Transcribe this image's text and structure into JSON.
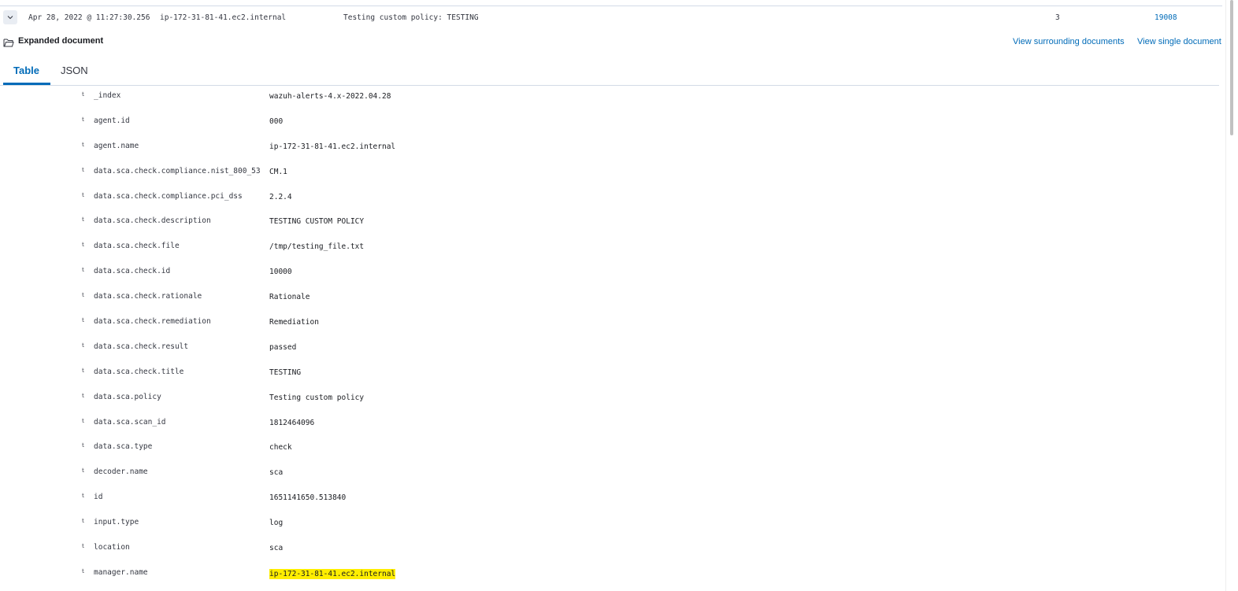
{
  "summary_row": {
    "timestamp": "Apr 28, 2022 @ 11:27:30.256",
    "host": "ip-172-31-81-41.ec2.internal",
    "description": "Testing custom policy: TESTING",
    "level": "3",
    "rule_id": "19008"
  },
  "expanded": {
    "title": "Expanded document",
    "link_surrounding": "View surrounding documents",
    "link_single": "View single document"
  },
  "tabs": {
    "table": "Table",
    "json": "JSON"
  },
  "field_type_glyph": "t",
  "fields": [
    {
      "name": "_index",
      "value": "wazuh-alerts-4.x-2022.04.28"
    },
    {
      "name": "agent.id",
      "value": "000"
    },
    {
      "name": "agent.name",
      "value": "ip-172-31-81-41.ec2.internal"
    },
    {
      "name": "data.sca.check.compliance.nist_800_53",
      "value": "CM.1"
    },
    {
      "name": "data.sca.check.compliance.pci_dss",
      "value": "2.2.4"
    },
    {
      "name": "data.sca.check.description",
      "value": "TESTING CUSTOM POLICY"
    },
    {
      "name": "data.sca.check.file",
      "value": "/tmp/testing_file.txt"
    },
    {
      "name": "data.sca.check.id",
      "value": "10000"
    },
    {
      "name": "data.sca.check.rationale",
      "value": "Rationale"
    },
    {
      "name": "data.sca.check.remediation",
      "value": "Remediation"
    },
    {
      "name": "data.sca.check.result",
      "value": "passed"
    },
    {
      "name": "data.sca.check.title",
      "value": "TESTING"
    },
    {
      "name": "data.sca.policy",
      "value": "Testing custom policy"
    },
    {
      "name": "data.sca.scan_id",
      "value": "1812464096"
    },
    {
      "name": "data.sca.type",
      "value": "check"
    },
    {
      "name": "decoder.name",
      "value": "sca"
    },
    {
      "name": "id",
      "value": "1651141650.513840"
    },
    {
      "name": "input.type",
      "value": "log"
    },
    {
      "name": "location",
      "value": "sca"
    },
    {
      "name": "manager.name",
      "value": "ip-172-31-81-41.ec2.internal",
      "highlighted": true
    }
  ],
  "colors": {
    "link": "#006bb8",
    "highlight": "#ffee00",
    "border": "#d3dae6"
  }
}
